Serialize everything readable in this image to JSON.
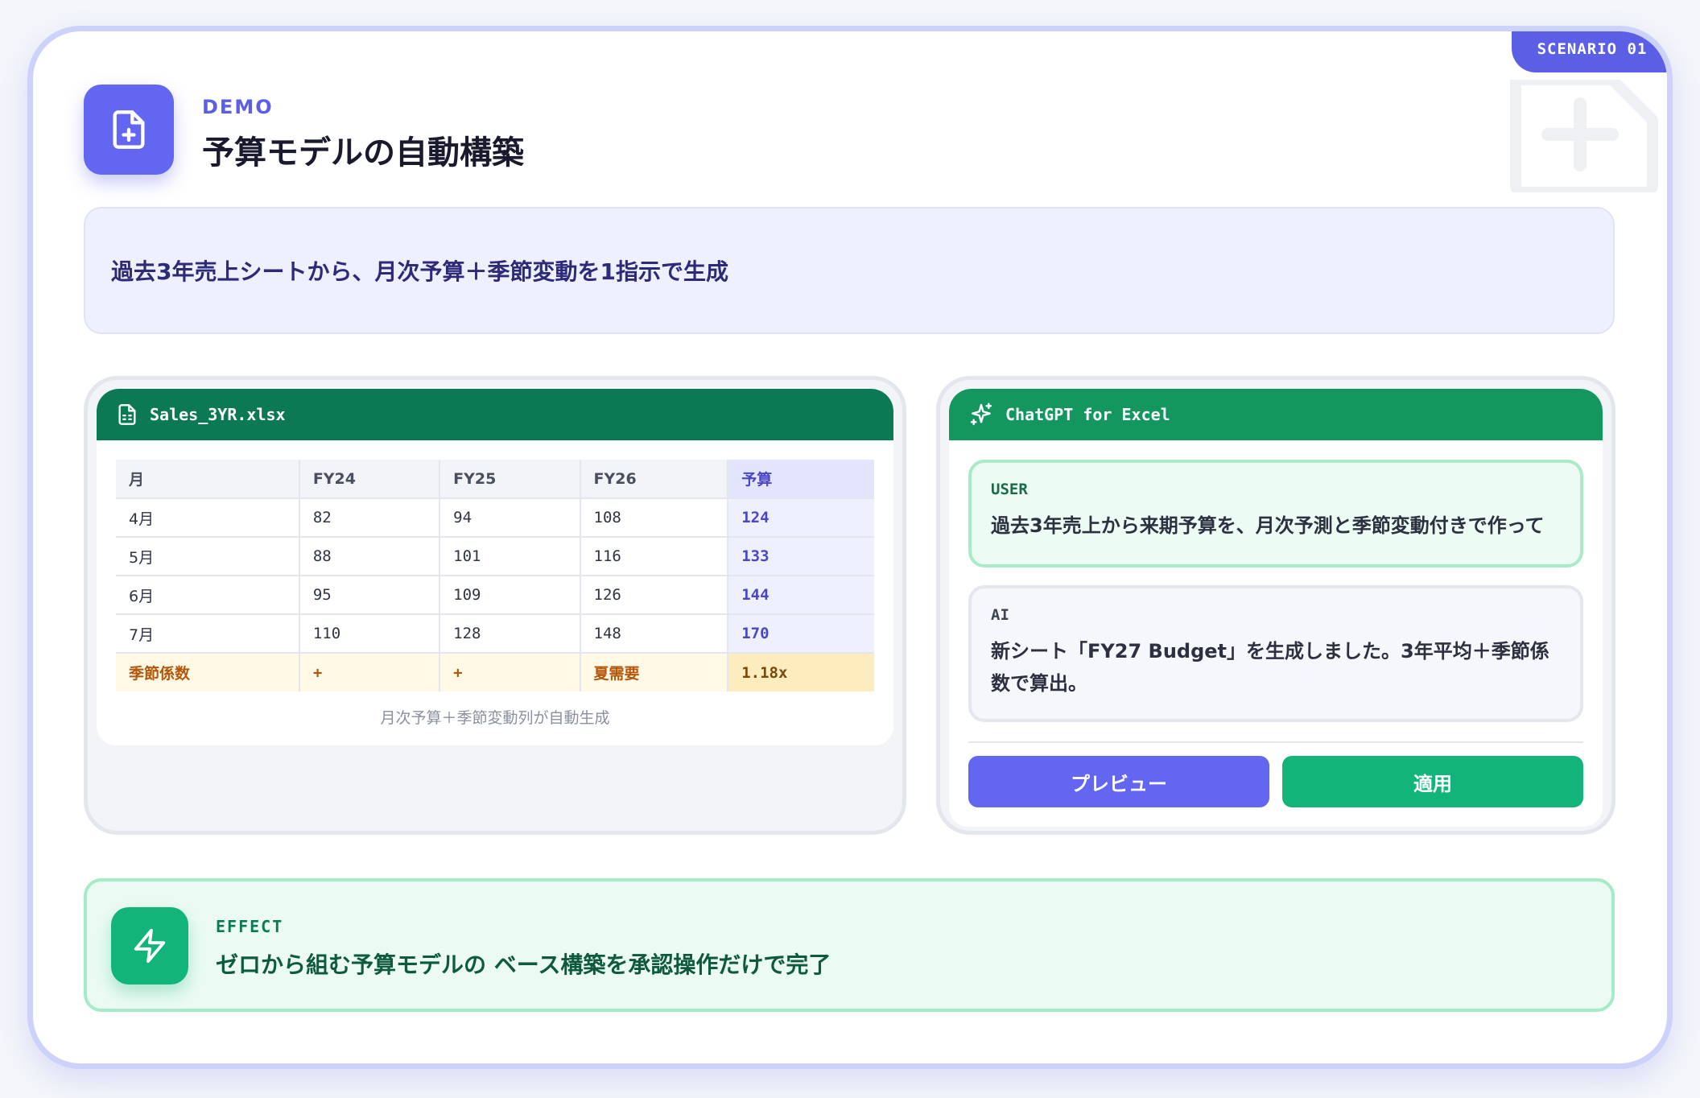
{
  "header": {
    "scenario_tag": "SCENARIO 01",
    "eyebrow": "DEMO",
    "title": "予算モデルの自動構築"
  },
  "prompt": {
    "text": "過去3年売上シートから、月次予算＋季節変動を1指示で生成"
  },
  "spreadsheet": {
    "file_name": "Sales_3YR.xlsx",
    "columns": [
      "月",
      "FY24",
      "FY25",
      "FY26",
      "予算"
    ],
    "rows": [
      [
        "4月",
        "82",
        "94",
        "108",
        "124"
      ],
      [
        "5月",
        "88",
        "101",
        "116",
        "133"
      ],
      [
        "6月",
        "95",
        "109",
        "126",
        "144"
      ],
      [
        "7月",
        "110",
        "128",
        "148",
        "170"
      ]
    ],
    "season_row": [
      "季節係数",
      "+",
      "+",
      "夏需要",
      "1.18x"
    ],
    "caption": "月次予算＋季節変動列が自動生成"
  },
  "chat": {
    "title": "ChatGPT for Excel",
    "user_role": "USER",
    "user_message": "過去3年売上から来期予算を、月次予測と季節変動付きで作って",
    "ai_role": "AI",
    "ai_message": "新シート「FY27 Budget」を生成しました。3年平均＋季節係数で算出。",
    "preview_label": "プレビュー",
    "apply_label": "適用"
  },
  "effect": {
    "label": "EFFECT",
    "text": "ゼロから組む予算モデルの ベース構築を承認操作だけで完了"
  },
  "colors": {
    "accent": "#6366f1",
    "excel_green": "#0b7a54",
    "success_green": "#12b47a",
    "season_orange": "#b3570a"
  },
  "icons": {
    "header": "file-plus-icon",
    "sheet": "spreadsheet-file-icon",
    "chat": "sparkles-icon",
    "effect": "lightning-bolt-icon"
  }
}
